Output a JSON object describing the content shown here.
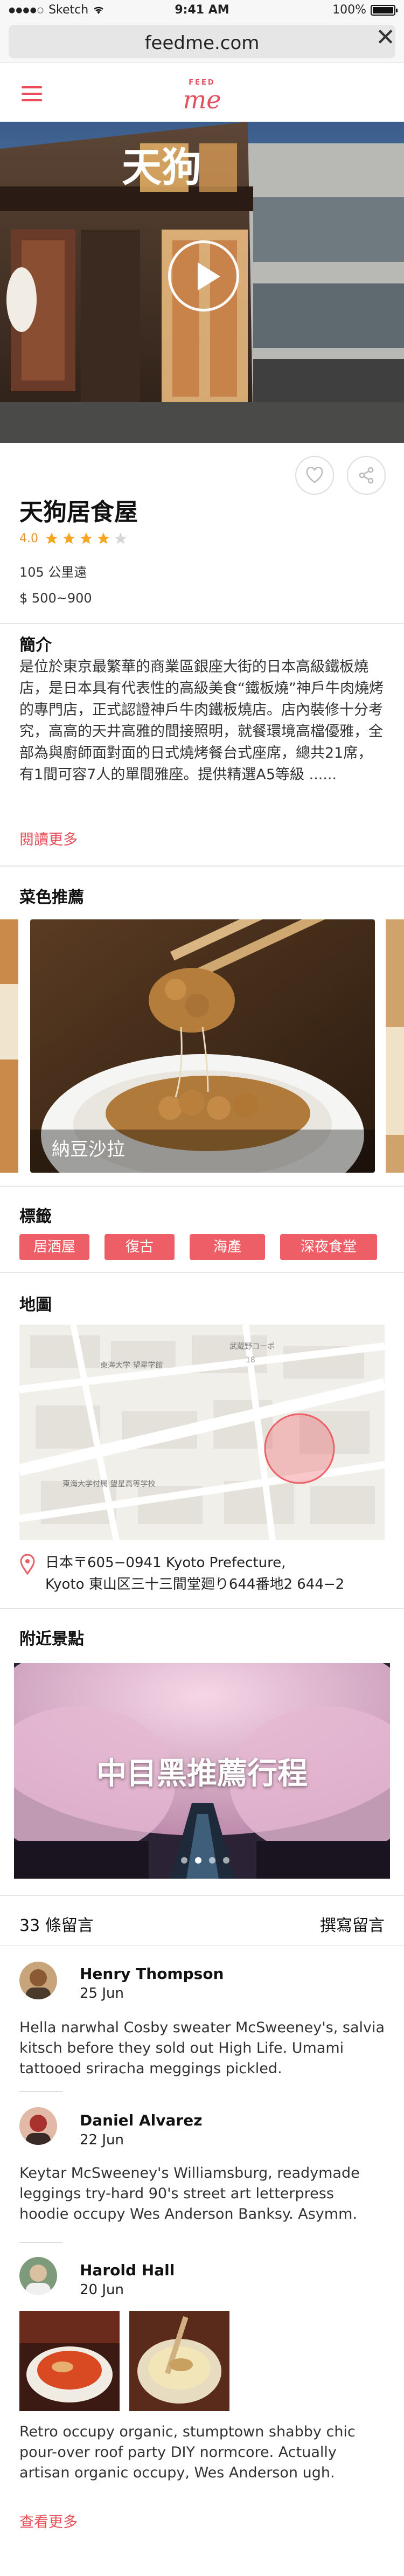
{
  "status_bar": {
    "signal": "●●●●○",
    "carrier": "Sketch",
    "time": "9:41 AM",
    "battery": "100%"
  },
  "browser": {
    "url": "feedme.com",
    "close_label": "✕"
  },
  "header": {
    "logo_top": "FEED",
    "logo_main": "me"
  },
  "hero": {
    "sign_text": "天狗"
  },
  "restaurant": {
    "name": "天狗居食屋",
    "rating": "4.0",
    "stars_filled": 4,
    "stars_total": 5,
    "distance": "105 公里遠",
    "price": "$ 500~900"
  },
  "intro": {
    "title": "簡介",
    "text": "是位於東京最繁華的商業區銀座大街的日本高級鐵板燒店，是日本具有代表性的高級美食“鐵板燒”神戶牛肉燒烤的專門店，正式認證神戶牛肉鐵板燒店。店內裝修十分考究，高高的天井高雅的間接照明，就餐環境高檔優雅，全部為與廚師面對面的日式燒烤餐台式座席，總共21席，有1間可容7人的單間雅座。提供精選A5等級 ......",
    "read_more": "閱讀更多"
  },
  "dishes": {
    "title": "菜色推薦",
    "items": [
      {
        "label": "納豆沙拉"
      }
    ]
  },
  "tags": {
    "title": "標籤",
    "items": [
      "居酒屋",
      "復古",
      "海產",
      "深夜食堂"
    ]
  },
  "map": {
    "title": "地圖",
    "labels": {
      "school": "東海大学 望星学館",
      "shop": "武蔵野コーポ",
      "school2": "東海大学付属 望星高等学校",
      "block": "18"
    },
    "address_line1": "日本〒605−0941 Kyoto Prefecture,",
    "address_line2": "Kyoto 東山区三十三間堂廻り644番地2 644−2"
  },
  "nearby": {
    "title": "附近景點",
    "banner_title": "中目黑推薦行程"
  },
  "comments": {
    "count_label": "33 條留言",
    "write_label": "撰寫留言",
    "items": [
      {
        "name": "Henry Thompson",
        "date": "25 Jun",
        "text": "Hella narwhal Cosby sweater McSweeney's, salvia kitsch before they sold out High Life. Umami tattooed sriracha meggings pickled."
      },
      {
        "name": "Daniel Alvarez",
        "date": "22 Jun",
        "text": "Keytar McSweeney's Williamsburg, readymade leggings try-hard 90's street art letterpress hoodie occupy Wes Anderson Banksy. Asymm."
      },
      {
        "name": "Harold Hall",
        "date": "20 Jun",
        "text": "Retro occupy organic, stumptown shabby chic pour-over roof party DIY normcore. Actually artisan organic occupy, Wes Anderson ugh."
      }
    ],
    "see_more": "查看更多"
  },
  "colors": {
    "accent": "#ee5e66",
    "star": "#f5a623",
    "rating_text": "#e39536"
  },
  "icons": {
    "menu": "hamburger-icon",
    "heart": "heart-icon",
    "share": "share-icon",
    "play": "play-icon",
    "pin": "location-pin-icon",
    "wifi": "wifi-icon"
  }
}
